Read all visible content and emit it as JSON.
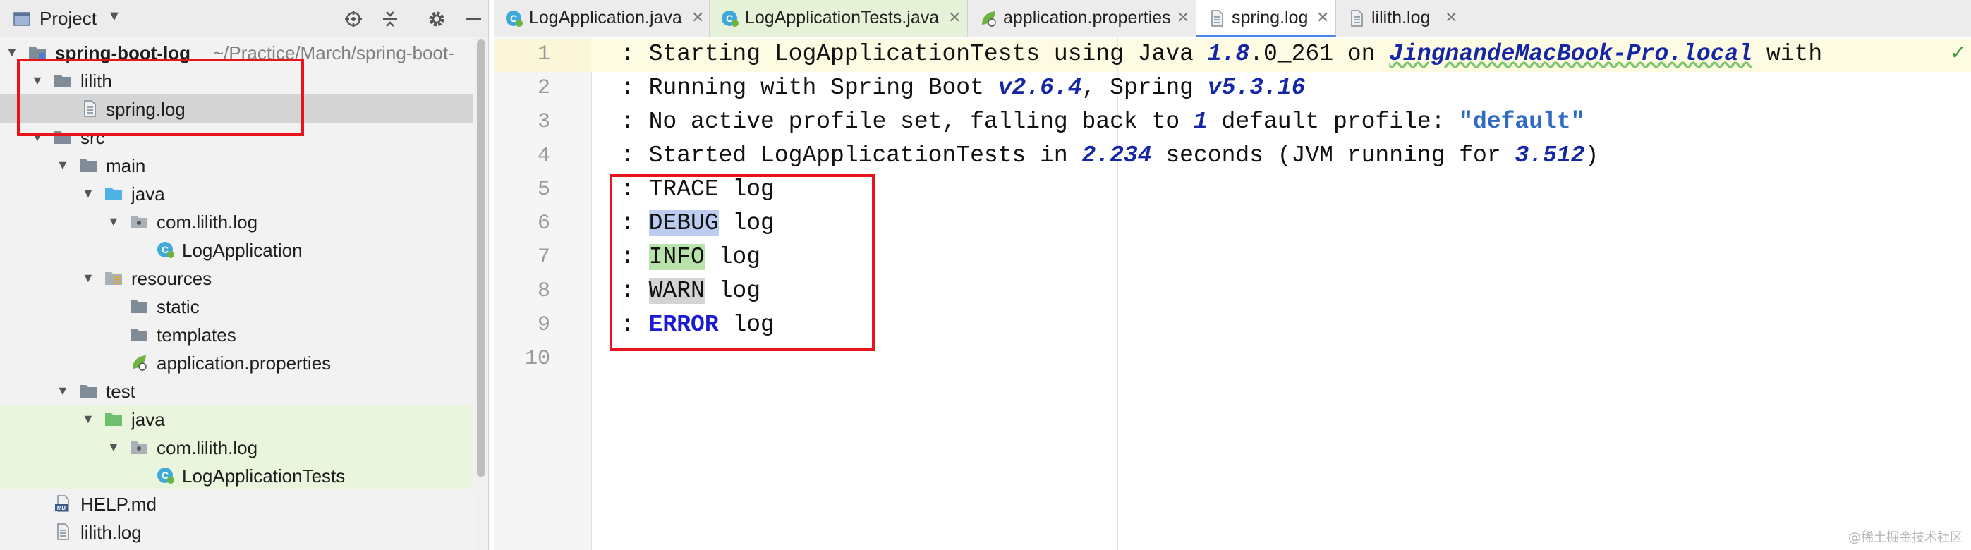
{
  "project_panel": {
    "title": "Project",
    "tree": [
      {
        "label": "spring-boot-log",
        "path": "~/Practice/March/spring-boot-",
        "depth": 0,
        "expanded": true,
        "icon": "module-folder-icon"
      },
      {
        "label": "lilith",
        "depth": 1,
        "expanded": true,
        "icon": "folder-icon"
      },
      {
        "label": "spring.log",
        "depth": 2,
        "icon": "file-icon",
        "selected": true
      },
      {
        "label": "src",
        "depth": 1,
        "expanded": true,
        "icon": "folder-icon"
      },
      {
        "label": "main",
        "depth": 2,
        "expanded": true,
        "icon": "folder-icon"
      },
      {
        "label": "java",
        "depth": 3,
        "expanded": true,
        "icon": "source-folder-icon"
      },
      {
        "label": "com.lilith.log",
        "depth": 4,
        "expanded": true,
        "icon": "package-icon"
      },
      {
        "label": "LogApplication",
        "depth": 5,
        "icon": "spring-class-icon"
      },
      {
        "label": "resources",
        "depth": 3,
        "expanded": true,
        "icon": "resources-folder-icon"
      },
      {
        "label": "static",
        "depth": 4,
        "icon": "folder-icon"
      },
      {
        "label": "templates",
        "depth": 4,
        "icon": "folder-icon"
      },
      {
        "label": "application.properties",
        "depth": 4,
        "icon": "spring-properties-icon"
      },
      {
        "label": "test",
        "depth": 2,
        "expanded": true,
        "icon": "folder-icon"
      },
      {
        "label": "java",
        "depth": 3,
        "expanded": true,
        "icon": "test-source-folder-icon",
        "test": true
      },
      {
        "label": "com.lilith.log",
        "depth": 4,
        "expanded": true,
        "icon": "package-icon",
        "test": true
      },
      {
        "label": "LogApplicationTests",
        "depth": 5,
        "icon": "spring-class-icon",
        "test": true
      },
      {
        "label": "HELP.md",
        "depth": 1,
        "icon": "markdown-file-icon"
      },
      {
        "label": "lilith.log",
        "depth": 1,
        "icon": "file-icon"
      }
    ]
  },
  "tabs": [
    {
      "label": "LogApplication.java",
      "icon": "spring-class-icon"
    },
    {
      "label": "LogApplicationTests.java",
      "icon": "spring-class-icon",
      "test": true
    },
    {
      "label": "application.properties",
      "icon": "spring-properties-icon"
    },
    {
      "label": "spring.log",
      "icon": "file-icon",
      "active": true
    },
    {
      "label": "lilith.log",
      "icon": "file-icon"
    }
  ],
  "editor": {
    "line_numbers": [
      "1",
      "2",
      "3",
      "4",
      "5",
      "6",
      "7",
      "8",
      "9",
      "10"
    ],
    "lines": [
      {
        "prefix": ": ",
        "t1": "Starting LogApplicationTests using Java ",
        "n1": "1.8",
        "t2": ".0_261 on ",
        "host": "JingnandeMacBook-Pro.local",
        "t3": " with"
      },
      {
        "prefix": ": ",
        "t1": "Running with Spring Boot ",
        "n1": "v2.6.4",
        "t2": ", Spring ",
        "n2": "v5.3.16"
      },
      {
        "prefix": ": ",
        "t1": "No active profile set, falling back to ",
        "n1": "1",
        "t2": " default profile: ",
        "str": "\"default\""
      },
      {
        "prefix": ": ",
        "t1": "Started LogApplicationTests in ",
        "n1": "2.234",
        "t2": " seconds (JVM running for ",
        "n2": "3.512",
        "t3": ")"
      },
      {
        "prefix": ": ",
        "kw": "TRACE",
        "rest": " log"
      },
      {
        "prefix": ": ",
        "kw": "DEBUG",
        "rest": " log"
      },
      {
        "prefix": ": ",
        "kw": "INFO",
        "rest": " log"
      },
      {
        "prefix": ": ",
        "kw": "WARN",
        "rest": " log"
      },
      {
        "prefix": ": ",
        "kw": "ERROR",
        "rest": " log"
      }
    ]
  },
  "watermark": "@稀土掘金技术社区",
  "colors": {
    "highlight_box": "#e8141b",
    "number": "#1627a6",
    "string": "#2f6bc1",
    "debug_bg": "#bccbf0",
    "info_bg": "#b8e3ab",
    "warn_bg": "#d4d4d4",
    "error_fg": "#1a1ad2"
  }
}
